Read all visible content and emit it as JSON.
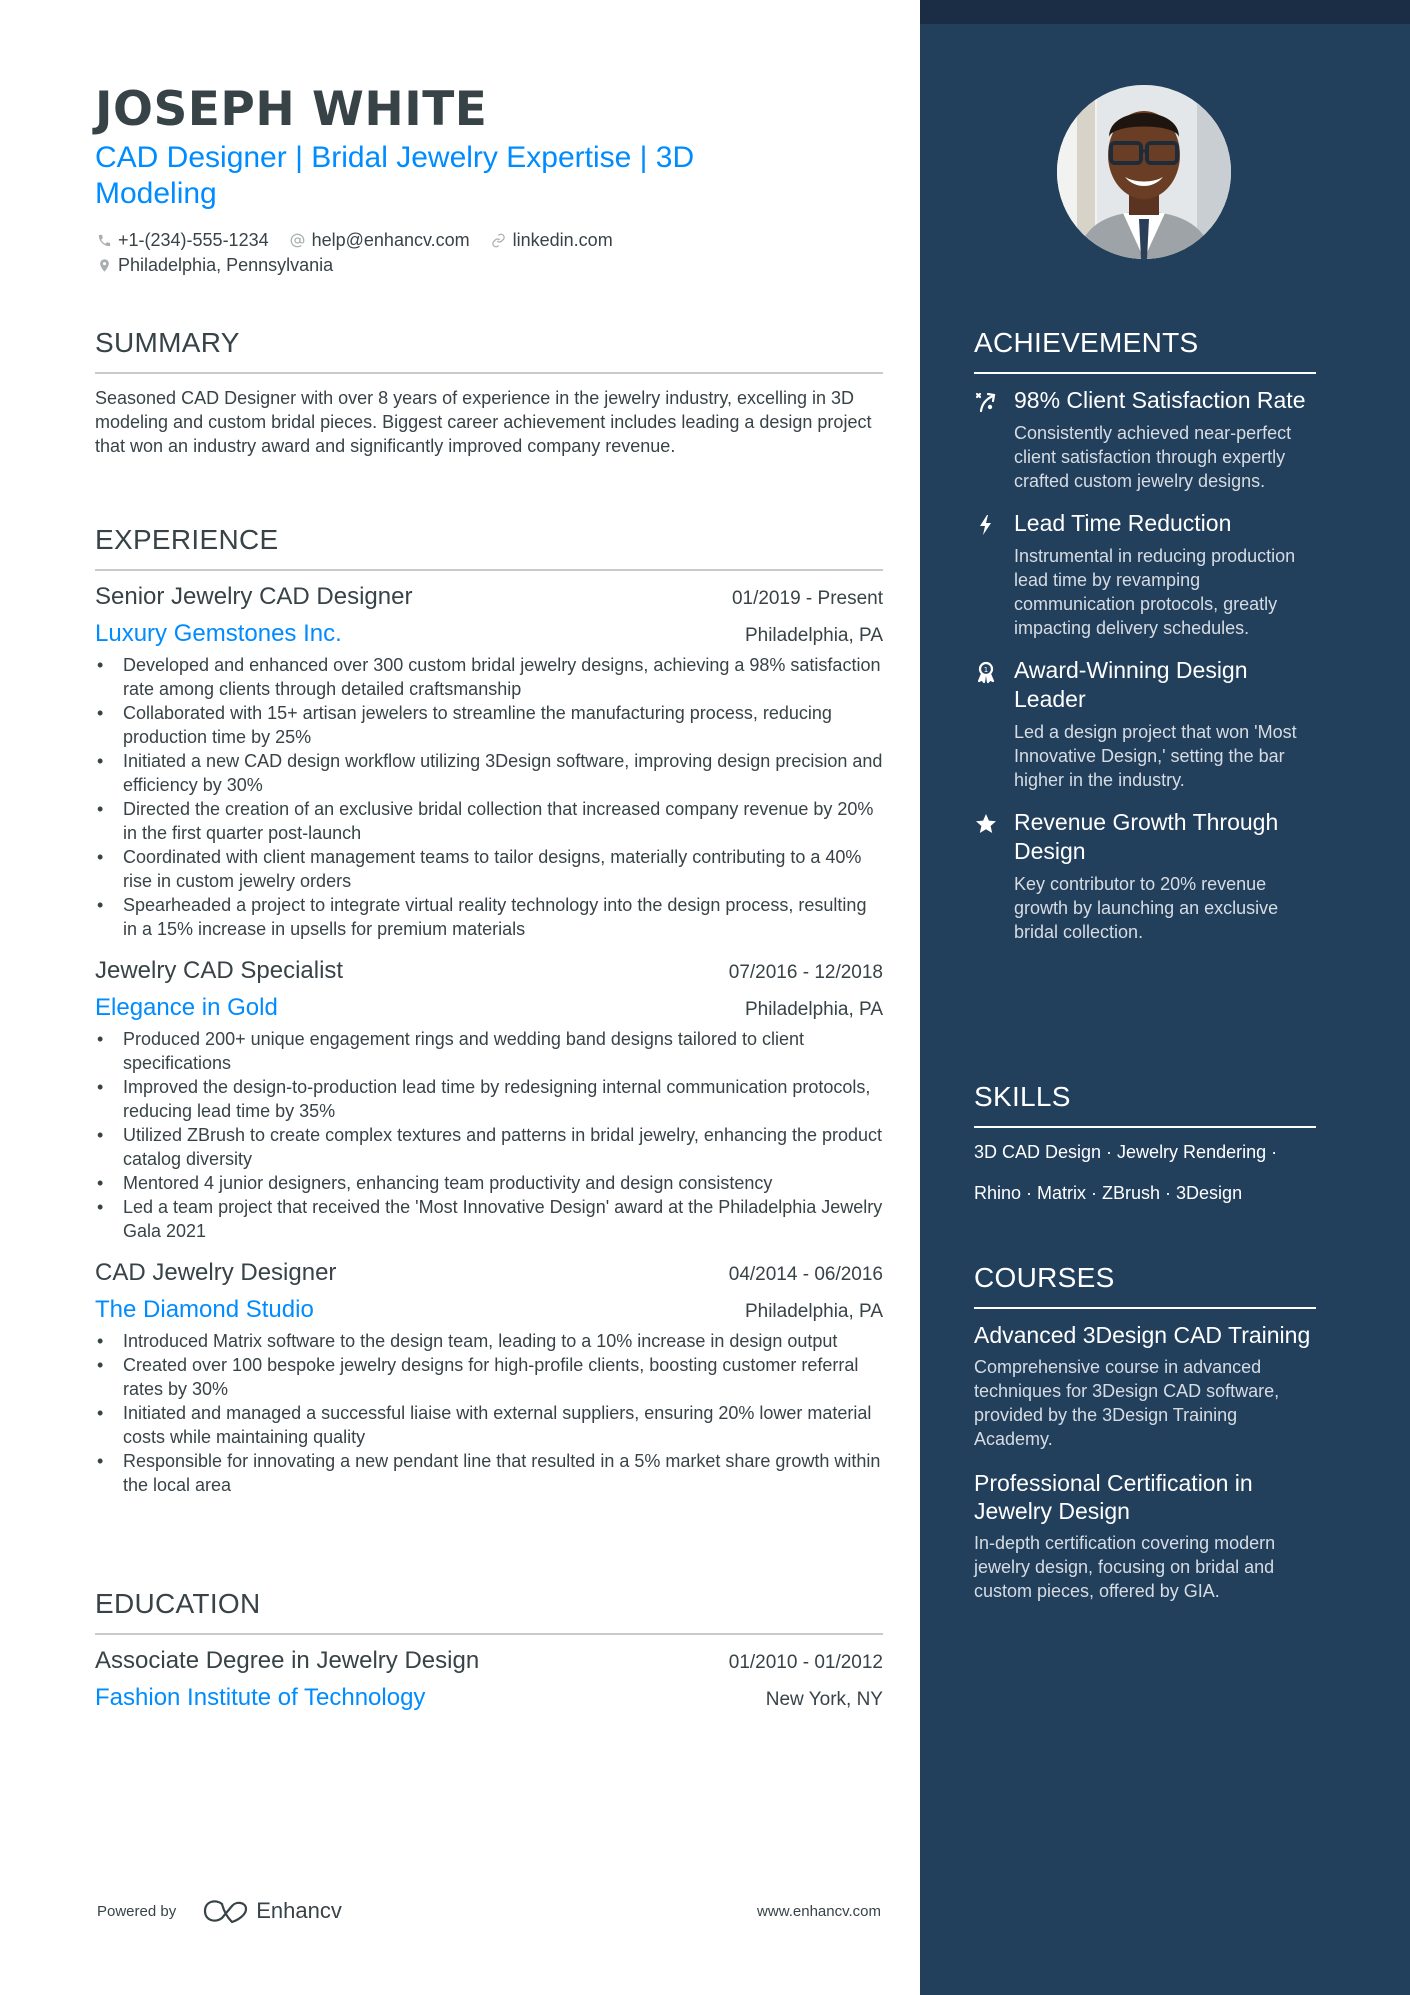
{
  "header": {
    "name": "JOSEPH WHITE",
    "headline": "CAD Designer | Bridal Jewelry Expertise | 3D Modeling",
    "contacts": {
      "phone": "+1-(234)-555-1234",
      "email": "help@enhancv.com",
      "link": "linkedin.com",
      "location": "Philadelphia, Pennsylvania"
    }
  },
  "summary": {
    "title": "SUMMARY",
    "text": "Seasoned CAD Designer with over 8 years of experience in the jewelry industry, excelling in 3D modeling and custom bridal pieces. Biggest career achievement includes leading a design project that won an industry award and significantly improved company revenue."
  },
  "experience": {
    "title": "EXPERIENCE",
    "jobs": [
      {
        "title": "Senior Jewelry CAD Designer",
        "dates": "01/2019 - Present",
        "company": "Luxury Gemstones Inc.",
        "location": "Philadelphia, PA",
        "bullets": [
          "Developed and enhanced over 300 custom bridal jewelry designs, achieving a 98% satisfaction rate among clients through detailed craftsmanship",
          "Collaborated with 15+ artisan jewelers to streamline the manufacturing process, reducing production time by 25%",
          "Initiated a new CAD design workflow utilizing 3Design software, improving design precision and efficiency by 30%",
          "Directed the creation of an exclusive bridal collection that increased company revenue by 20% in the first quarter post-launch",
          "Coordinated with client management teams to tailor designs, materially contributing to a 40% rise in custom jewelry orders",
          "Spearheaded a project to integrate virtual reality technology into the design process, resulting in a 15% increase in upsells for premium materials"
        ]
      },
      {
        "title": "Jewelry CAD Specialist",
        "dates": "07/2016 - 12/2018",
        "company": "Elegance in Gold",
        "location": "Philadelphia, PA",
        "bullets": [
          "Produced 200+ unique engagement rings and wedding band designs tailored to client specifications",
          "Improved the design-to-production lead time by redesigning internal communication protocols, reducing lead time by 35%",
          "Utilized ZBrush to create complex textures and patterns in bridal jewelry, enhancing the product catalog diversity",
          "Mentored 4 junior designers, enhancing team productivity and design consistency",
          "Led a team project that received the 'Most Innovative Design' award at the Philadelphia Jewelry Gala 2021"
        ]
      },
      {
        "title": "CAD Jewelry Designer",
        "dates": "04/2014 - 06/2016",
        "company": "The Diamond Studio",
        "location": "Philadelphia, PA",
        "bullets": [
          "Introduced Matrix software to the design team, leading to a 10% increase in design output",
          "Created over 100 bespoke jewelry designs for high-profile clients, boosting customer referral rates by 30%",
          "Initiated and managed a successful liaise with external suppliers, ensuring 20% lower material costs while maintaining quality",
          "Responsible for innovating a new pendant line that resulted in a 5% market share growth within the local area"
        ]
      }
    ]
  },
  "education": {
    "title": "EDUCATION",
    "items": [
      {
        "degree": "Associate Degree in Jewelry Design",
        "dates": "01/2010 - 01/2012",
        "school": "Fashion Institute of Technology",
        "location": "New York, NY"
      }
    ]
  },
  "footer": {
    "powered_by": "Powered by",
    "brand": "Enhancv",
    "url": "www.enhancv.com"
  },
  "sidebar": {
    "photo_alt": "Profile photo",
    "achievements": {
      "title": "ACHIEVEMENTS",
      "items": [
        {
          "icon": "strategy-icon",
          "title": "98% Client Satisfaction Rate",
          "desc": "Consistently achieved near-perfect client satisfaction through expertly crafted custom jewelry designs."
        },
        {
          "icon": "lightning-icon",
          "title": "Lead Time Reduction",
          "desc": "Instrumental in reducing production lead time by revamping communication protocols, greatly impacting delivery schedules."
        },
        {
          "icon": "award-ribbon-icon",
          "title": "Award-Winning Design Leader",
          "desc": "Led a design project that won 'Most Innovative Design,' setting the bar higher in the industry."
        },
        {
          "icon": "star-icon",
          "title": "Revenue Growth Through Design",
          "desc": "Key contributor to 20% revenue growth by launching an exclusive bridal collection."
        }
      ]
    },
    "skills": {
      "title": "SKILLS",
      "line1": "3D CAD Design · Jewelry Rendering ·",
      "line2": "Rhino · Matrix · ZBrush · 3Design"
    },
    "courses": {
      "title": "COURSES",
      "items": [
        {
          "title": "Advanced 3Design CAD Training",
          "desc": "Comprehensive course in advanced techniques for 3Design CAD software, provided by the 3Design Training Academy."
        },
        {
          "title": "Professional Certification in Jewelry Design",
          "desc": "In-depth certification covering modern jewelry design, focusing on bridal and custom pieces, offered by GIA."
        }
      ]
    }
  },
  "colors": {
    "accent": "#008CFF",
    "text": "#384347",
    "sidebar_bg": "#223F5C",
    "sidebar_top": "#1B2D44"
  }
}
